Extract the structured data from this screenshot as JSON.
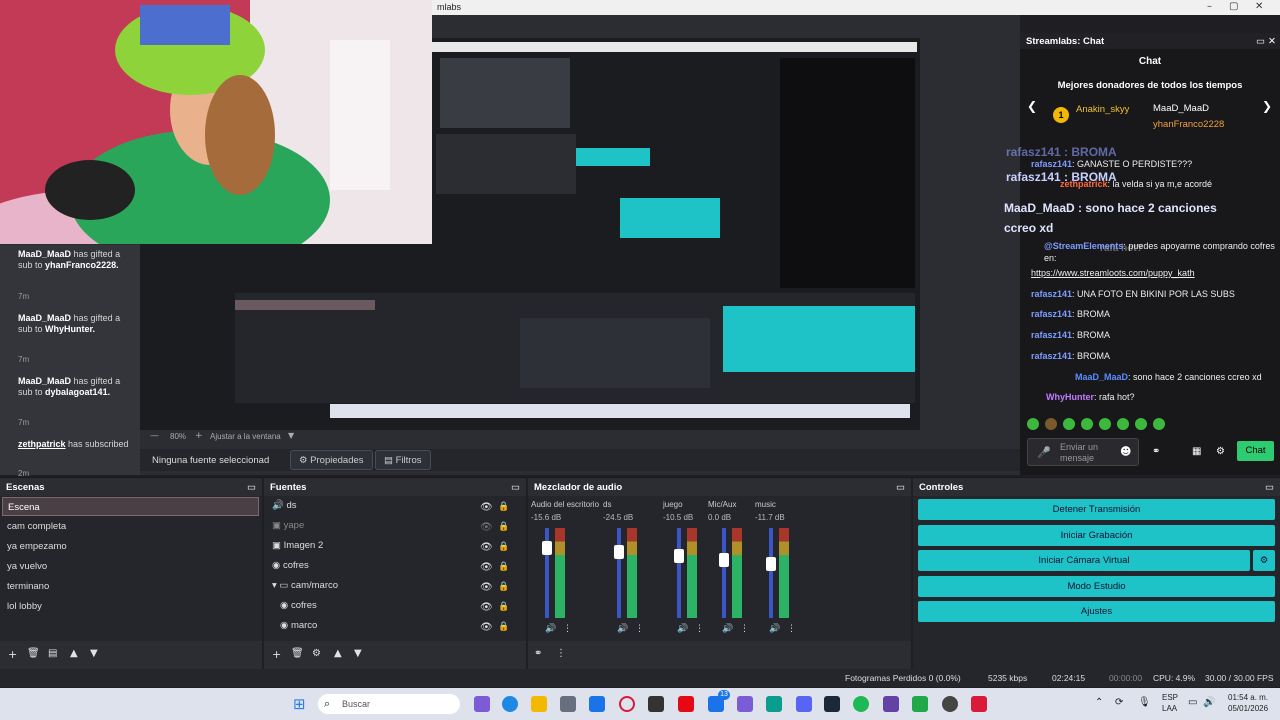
{
  "window": {
    "title_fragment": "mlabs"
  },
  "left_chat": [
    {
      "user": "MaaD_MaaD",
      "text": "has gifted a sub to",
      "target": "yhanFranco2228.",
      "time": "7m"
    },
    {
      "user": "MaaD_MaaD",
      "text": "has gifted a sub to",
      "target": "WhyHunter.",
      "time": "7m"
    },
    {
      "user": "MaaD_MaaD",
      "text": "has gifted a sub to",
      "target": "dybalagoat141.",
      "time": "7m"
    },
    {
      "user": "zethpatrick",
      "text": "has subscribed",
      "target": "",
      "time": "2m"
    }
  ],
  "preview": {
    "zoom": "80%",
    "fit": "Ajustar a la ventana"
  },
  "source_info": {
    "label": "Ninguna fuente seleccionad",
    "props": "Propiedades",
    "filters": "Filtros"
  },
  "chat_panel": {
    "title": "Streamlabs: Chat",
    "header": "Chat",
    "donors_title": "Mejores donadores de todos los tiempos",
    "donor1": "Anakin_skyy",
    "donor2": "MaaD_MaaD",
    "donor3": "yhanFranco2228",
    "donor_count": "1",
    "overlay_lines": [
      "rafasz141 : BROMA",
      "rafasz141 : BROMA",
      "MaaD_MaaD : sono hace 2 canciones ccreo xd",
      "rafa hot?"
    ],
    "messages": [
      {
        "user": "rafasz141",
        "text": ": GANASTE O PERDISTE???"
      },
      {
        "user": "zethpatrick",
        "text": ": la velda si ya m,e acordé"
      },
      {
        "user": "@StreamElements",
        "text": ": puedes apoyarme comprando cofres en:"
      },
      {
        "user": "",
        "text": "https://www.streamloots.com/puppy_kath"
      },
      {
        "user": "rafasz141",
        "text": ": UNA FOTO EN BIKINI POR LAS SUBS"
      },
      {
        "user": "rafasz141",
        "text": ": BROMA"
      },
      {
        "user": "rafasz141",
        "text": ": BROMA"
      },
      {
        "user": "rafasz141",
        "text": ": BROMA"
      },
      {
        "user": "MaaD_MaaD",
        "text": ": sono hace 2 canciones ccreo xd"
      },
      {
        "user": "WhyHunter",
        "text": ": rafa hot?"
      }
    ],
    "input_placeholder": "Enviar un mensaje",
    "send_label": "Chat"
  },
  "scenes": {
    "title": "Escenas",
    "items": [
      "Escena",
      "cam completa",
      "ya empezamo",
      "ya vuelvo",
      "terminano",
      "lol lobby"
    ]
  },
  "sources": {
    "title": "Fuentes",
    "items": [
      "ds",
      "yape",
      "Imagen 2",
      "cofres",
      "cam/marco",
      "cofres",
      "marco"
    ]
  },
  "mixer": {
    "title": "Mezclador de audio",
    "channels": [
      {
        "name": "Audio del escritorio",
        "db": "-15.6 dB"
      },
      {
        "name": "ds",
        "db": "-24.5 dB"
      },
      {
        "name": "juego",
        "db": "-10.5 dB"
      },
      {
        "name": "Mic/Aux",
        "db": "0.0 dB"
      },
      {
        "name": "music",
        "db": "-11.7 dB"
      }
    ],
    "scale": [
      "0",
      "-5",
      "-10",
      "-15",
      "-20",
      "-25",
      "-30",
      "-35",
      "-40",
      "-45",
      "-50",
      "-55",
      "-60"
    ]
  },
  "controls": {
    "title": "Controles",
    "stop_stream": "Detener Transmisión",
    "start_record": "Iniciar Grabación",
    "virtual_cam": "Iniciar Cámara Virtual",
    "studio_mode": "Modo Estudio",
    "settings": "Ajustes"
  },
  "status": {
    "dropped": "Fotogramas Perdidos 0 (0.0%)",
    "bitrate": "5235 kbps",
    "stream_time": "02:24:15",
    "rec_time": "00:00:00",
    "cpu": "CPU: 4.9%",
    "fps": "30.00 / 30.00 FPS"
  },
  "taskbar": {
    "search": "Buscar",
    "lang": "ESP",
    "lang2": "LAA",
    "time": "01:54 a. m.",
    "date": "05/01/2026",
    "badge": "13"
  }
}
